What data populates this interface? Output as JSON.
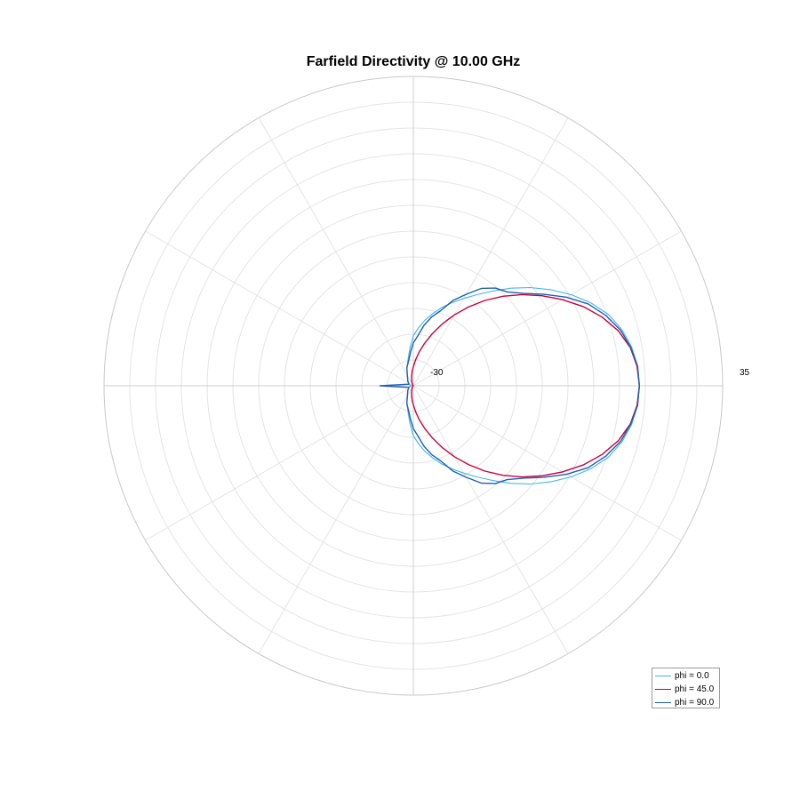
{
  "chart_data": {
    "type": "line",
    "projection": "polar",
    "title": "Farfield Directivity @ 10.00 GHz",
    "radial_range": [
      -30,
      35
    ],
    "radial_tick_labels": [
      "-30",
      "35"
    ],
    "angle_zero": "right",
    "grid": true,
    "legend": "bottom-right",
    "series": [
      {
        "name": "phi = 0.0",
        "color": "#41b6e6",
        "theta_deg": [
          0,
          5,
          10,
          15,
          20,
          25,
          30,
          35,
          40,
          45,
          50,
          55,
          60,
          65,
          70,
          75,
          80,
          85,
          90,
          95,
          100,
          110,
          120,
          140,
          160,
          180
        ],
        "values": [
          17.5,
          17.3,
          16.6,
          15.4,
          13.7,
          11.2,
          8.3,
          5.2,
          2.1,
          -1.0,
          -4.0,
          -6.6,
          -8.8,
          -10.7,
          -12.5,
          -14.3,
          -16.0,
          -17.8,
          -19.5,
          -22,
          -24,
          -26,
          -27.5,
          -28.5,
          -29,
          -29.5
        ]
      },
      {
        "name": "phi = 45.0",
        "color": "#c8003c",
        "theta_deg": [
          0,
          5,
          10,
          15,
          20,
          25,
          30,
          35,
          40,
          45,
          50,
          55,
          60,
          65,
          70,
          75,
          80,
          85,
          90,
          95,
          100,
          110,
          120,
          140,
          160,
          180
        ],
        "values": [
          17.5,
          17.2,
          16.3,
          14.6,
          12.2,
          9.4,
          6.2,
          3.0,
          -0.2,
          -3.4,
          -6.6,
          -9.8,
          -12.8,
          -15.7,
          -18.4,
          -20.7,
          -22.7,
          -24.5,
          -26.0,
          -27,
          -28,
          -29,
          -29.5,
          -29.8,
          -30,
          -30
        ]
      },
      {
        "name": "phi = 90.0",
        "color": "#1f5fb4",
        "theta_deg": [
          0,
          5,
          10,
          15,
          20,
          25,
          30,
          35,
          40,
          45,
          50,
          55,
          60,
          65,
          70,
          75,
          80,
          85,
          90,
          95,
          100,
          110,
          120,
          140,
          160,
          180
        ],
        "values": [
          17.5,
          17.3,
          16.4,
          15.1,
          13.1,
          10.6,
          7.2,
          3.5,
          0.2,
          -2.1,
          -3.2,
          -5.0,
          -7.8,
          -10.2,
          -13.2,
          -15.0,
          -17.1,
          -19.5,
          -21.0,
          -23,
          -24.5,
          -26,
          -27.5,
          -28.5,
          -29,
          -23
        ]
      }
    ]
  }
}
